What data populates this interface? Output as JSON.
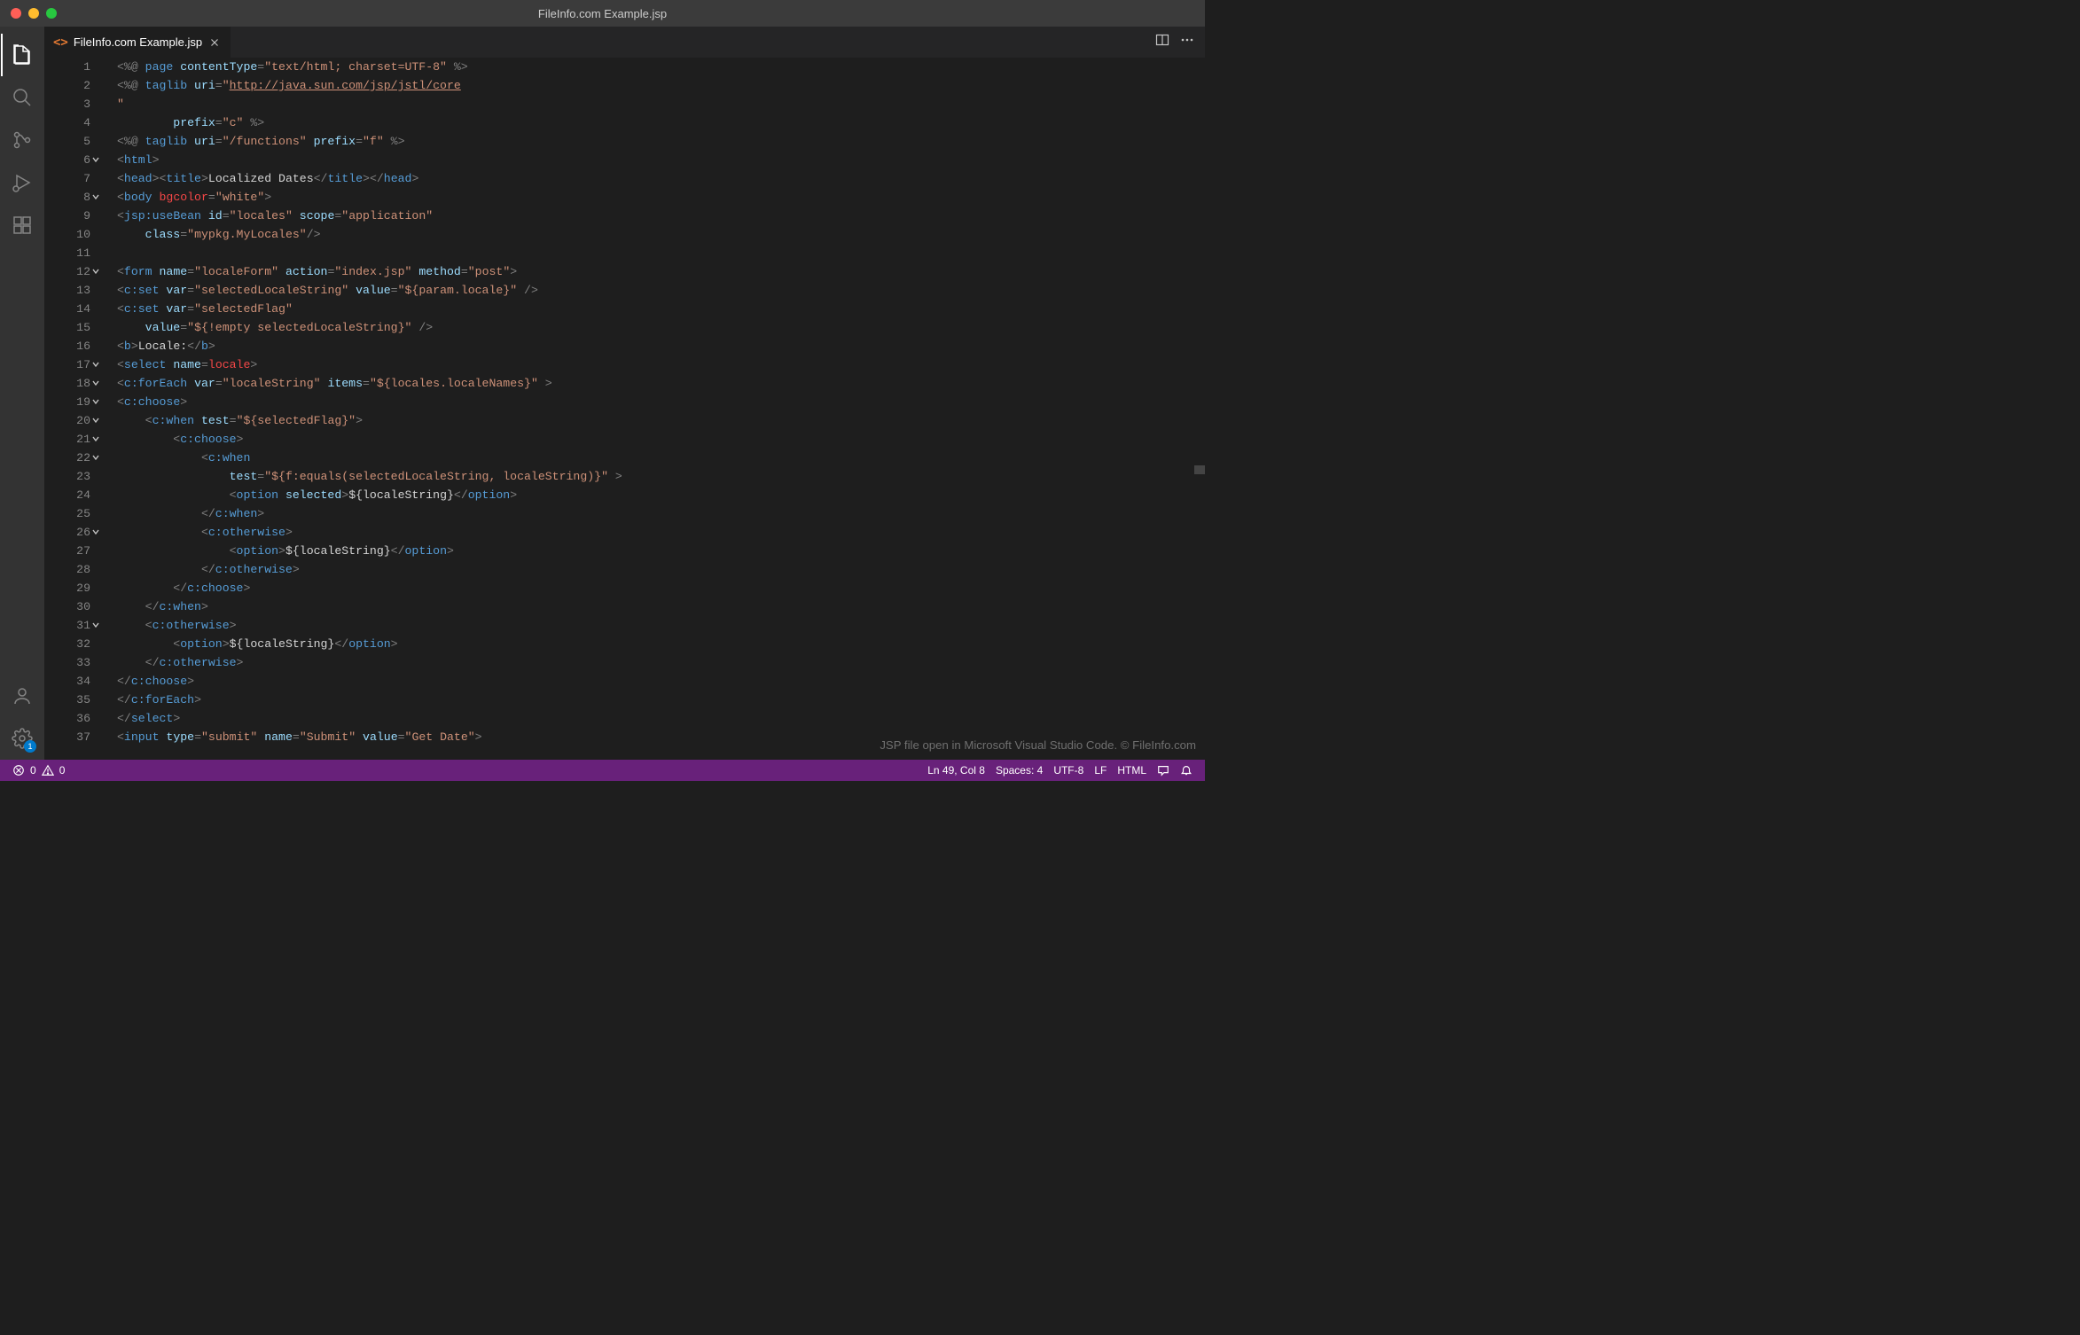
{
  "window": {
    "title": "FileInfo.com Example.jsp"
  },
  "tab": {
    "filename": "FileInfo.com Example.jsp",
    "langIcon": "<>"
  },
  "gutter": {
    "lines": [
      "1",
      "2",
      "3",
      "4",
      "5",
      "6",
      "7",
      "8",
      "9",
      "10",
      "11",
      "12",
      "13",
      "14",
      "15",
      "16",
      "17",
      "18",
      "19",
      "20",
      "21",
      "22",
      "23",
      "24",
      "25",
      "26",
      "27",
      "28",
      "29",
      "30",
      "31",
      "32",
      "33",
      "34",
      "35",
      "36",
      "37"
    ],
    "folds": [
      6,
      8,
      12,
      17,
      18,
      19,
      20,
      21,
      22,
      26,
      31
    ]
  },
  "code": {
    "l1": {
      "a": "<%@ ",
      "b": "page",
      "c": " contentType",
      "d": "=",
      "e": "\"text/html; charset=UTF-8\"",
      "f": " %>"
    },
    "l2": {
      "a": "<%@ ",
      "b": "taglib",
      "c": " uri",
      "d": "=",
      "e": "\"",
      "url": "http://java.sun.com/jsp/jstl/core"
    },
    "l3": {
      "a": "\""
    },
    "l4": {
      "a": "        prefix",
      "b": "=",
      "c": "\"c\"",
      "d": " %>"
    },
    "l5": {
      "a": "<%@ ",
      "b": "taglib",
      "c": " uri",
      "d": "=",
      "e": "\"/functions\"",
      "f": " prefix",
      "g": "=",
      "h": "\"f\"",
      "i": " %>"
    },
    "l6": {
      "a": "<",
      "b": "html",
      "c": ">"
    },
    "l7": {
      "a": "<",
      "b": "head",
      "c": "><",
      "d": "title",
      "e": ">",
      "txt": "Localized Dates",
      "f": "</",
      "g": "title",
      "h": "></",
      "i": "head",
      "j": ">"
    },
    "l8": {
      "a": "<",
      "b": "body",
      "c": " bgcolor",
      "d": "=",
      "e": "\"white\"",
      "f": ">"
    },
    "l9": {
      "a": "<",
      "b": "jsp:useBean",
      "c": " id",
      "d": "=",
      "e": "\"locales\"",
      "f": " scope",
      "g": "=",
      "h": "\"application\""
    },
    "l10": {
      "a": "    class",
      "b": "=",
      "c": "\"mypkg.MyLocales\"",
      "d": "/>"
    },
    "l11": {
      "a": ""
    },
    "l12": {
      "a": "<",
      "b": "form",
      "c": " name",
      "d": "=",
      "e": "\"localeForm\"",
      "f": " action",
      "g": "=",
      "h": "\"index.jsp\"",
      "i": " method",
      "j": "=",
      "k": "\"post\"",
      "l": ">"
    },
    "l13": {
      "a": "<",
      "b": "c:set",
      "c": " var",
      "d": "=",
      "e": "\"selectedLocaleString\"",
      "f": " value",
      "g": "=",
      "h": "\"${param.locale}\"",
      "i": " />"
    },
    "l14": {
      "a": "<",
      "b": "c:set",
      "c": " var",
      "d": "=",
      "e": "\"selectedFlag\""
    },
    "l15": {
      "a": "    value",
      "b": "=",
      "c": "\"${!empty selectedLocaleString}\"",
      "d": " />"
    },
    "l16": {
      "a": "<",
      "b": "b",
      "c": ">",
      "txt": "Locale:",
      "d": "</",
      "e": "b",
      "f": ">"
    },
    "l17": {
      "a": "<",
      "b": "select",
      "c": " name",
      "d": "=",
      "e": "locale",
      "f": ">"
    },
    "l18": {
      "a": "<",
      "b": "c:forEach",
      "c": " var",
      "d": "=",
      "e": "\"localeString\"",
      "f": " items",
      "g": "=",
      "h": "\"${locales.localeNames}\"",
      "i": " >"
    },
    "l19": {
      "a": "<",
      "b": "c:choose",
      "c": ">"
    },
    "l20": {
      "a": "    <",
      "b": "c:when",
      "c": " test",
      "d": "=",
      "e": "\"${selectedFlag}\"",
      "f": ">"
    },
    "l21": {
      "a": "        <",
      "b": "c:choose",
      "c": ">"
    },
    "l22": {
      "a": "            <",
      "b": "c:when"
    },
    "l23": {
      "a": "                test",
      "b": "=",
      "c": "\"${f:equals(selectedLocaleString, localeString)}\"",
      "d": " >"
    },
    "l24": {
      "a": "                <",
      "b": "option",
      "c": " selected",
      "d": ">",
      "txt": "${localeString}",
      "e": "</",
      "f": "option",
      "g": ">"
    },
    "l25": {
      "a": "            </",
      "b": "c:when",
      "c": ">"
    },
    "l26": {
      "a": "            <",
      "b": "c:otherwise",
      "c": ">"
    },
    "l27": {
      "a": "                <",
      "b": "option",
      "c": ">",
      "txt": "${localeString}",
      "d": "</",
      "e": "option",
      "f": ">"
    },
    "l28": {
      "a": "            </",
      "b": "c:otherwise",
      "c": ">"
    },
    "l29": {
      "a": "        </",
      "b": "c:choose",
      "c": ">"
    },
    "l30": {
      "a": "    </",
      "b": "c:when",
      "c": ">"
    },
    "l31": {
      "a": "    <",
      "b": "c:otherwise",
      "c": ">"
    },
    "l32": {
      "a": "        <",
      "b": "option",
      "c": ">",
      "txt": "${localeString}",
      "d": "</",
      "e": "option",
      "f": ">"
    },
    "l33": {
      "a": "    </",
      "b": "c:otherwise",
      "c": ">"
    },
    "l34": {
      "a": "</",
      "b": "c:choose",
      "c": ">"
    },
    "l35": {
      "a": "</",
      "b": "c:forEach",
      "c": ">"
    },
    "l36": {
      "a": "</",
      "b": "select",
      "c": ">"
    },
    "l37": {
      "a": "<",
      "b": "input",
      "c": " type",
      "d": "=",
      "e": "\"submit\"",
      "f": " name",
      "g": "=",
      "h": "\"Submit\"",
      "i": " value",
      "j": "=",
      "k": "\"Get Date\"",
      "l": ">"
    }
  },
  "watermark": "JSP file open in Microsoft Visual Studio Code. © FileInfo.com",
  "status": {
    "errors": "0",
    "warnings": "0",
    "ln_col": "Ln 49, Col 8",
    "spaces": "Spaces: 4",
    "encoding": "UTF-8",
    "eol": "LF",
    "language": "HTML"
  },
  "activity": {
    "settings_badge": "1"
  }
}
